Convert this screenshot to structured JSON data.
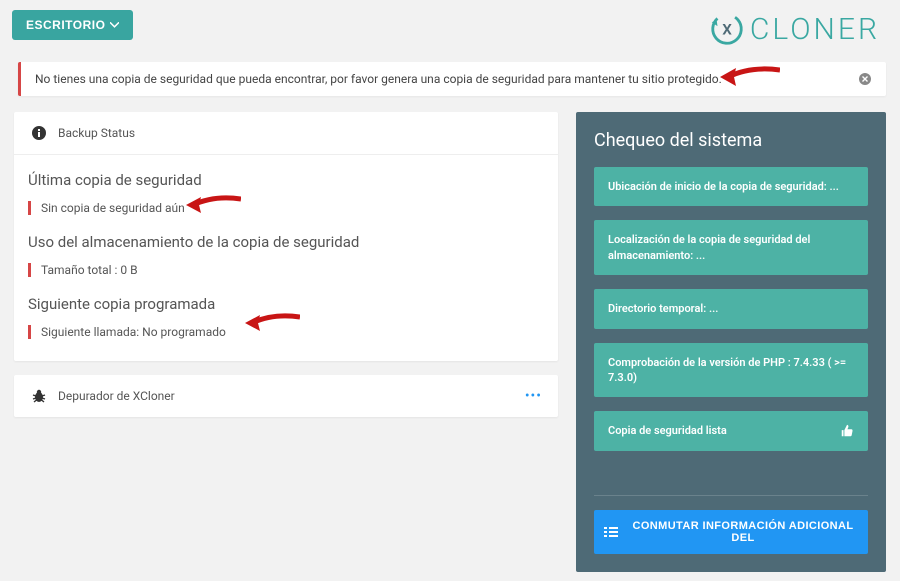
{
  "header": {
    "escritorio_label": "ESCRITORIO",
    "logo_text": "CLONER"
  },
  "alert": {
    "message": "No tienes una copia de seguridad que pueda encontrar, por favor genera una copia de seguridad para mantener tu sitio protegido."
  },
  "backup_status": {
    "card_title": "Backup Status",
    "sections": {
      "last_backup_title": "Última copia de seguridad",
      "last_backup_status": "Sin copia de seguridad aún",
      "storage_title": "Uso del almacenamiento de la copia de seguridad",
      "storage_status": "Tamaño total : 0 B",
      "next_title": "Siguiente copia programada",
      "next_status": "Siguiente llamada: No programado"
    }
  },
  "debugger": {
    "label": "Depurador de XCloner"
  },
  "system_check": {
    "title": "Chequeo del sistema",
    "items": [
      "Ubicación de inicio de la copia de seguridad: ...",
      "Localización de la copia de seguridad del almacenamiento: ...",
      "Directorio temporal: ...",
      "Comprobación de la versión de PHP : 7.4.33 ( >= 7.3.0)",
      "Copia de seguridad lista"
    ],
    "toggle_label": "CONMUTAR INFORMACIÓN ADICIONAL DEL"
  }
}
